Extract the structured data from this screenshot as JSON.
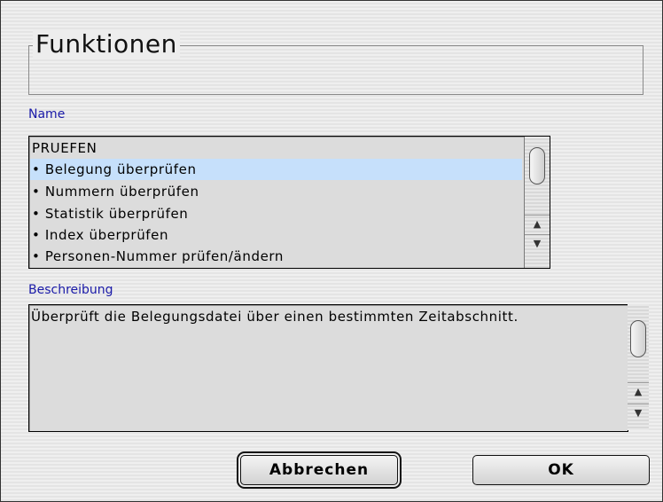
{
  "dialog": {
    "title": "Funktionen"
  },
  "name_section": {
    "label": "Name",
    "items": [
      {
        "text": "PRUEFEN",
        "selected": false
      },
      {
        "text": "• Belegung überprüfen",
        "selected": true
      },
      {
        "text": "• Nummern überprüfen",
        "selected": false
      },
      {
        "text": "• Statistik überprüfen",
        "selected": false
      },
      {
        "text": "• Index überprüfen",
        "selected": false
      },
      {
        "text": "• Personen-Nummer prüfen/ändern",
        "selected": false
      }
    ]
  },
  "description_section": {
    "label": "Beschreibung",
    "text": "Überprüft die Belegungsdatei über einen bestimmten Zeitabschnitt."
  },
  "buttons": {
    "cancel": "Abbrechen",
    "ok": "OK"
  },
  "icons": {
    "scroll_up": "▲",
    "scroll_down": "▼"
  },
  "colors": {
    "selection": "#c6e0fb",
    "label_blue": "#1a1aa8"
  }
}
